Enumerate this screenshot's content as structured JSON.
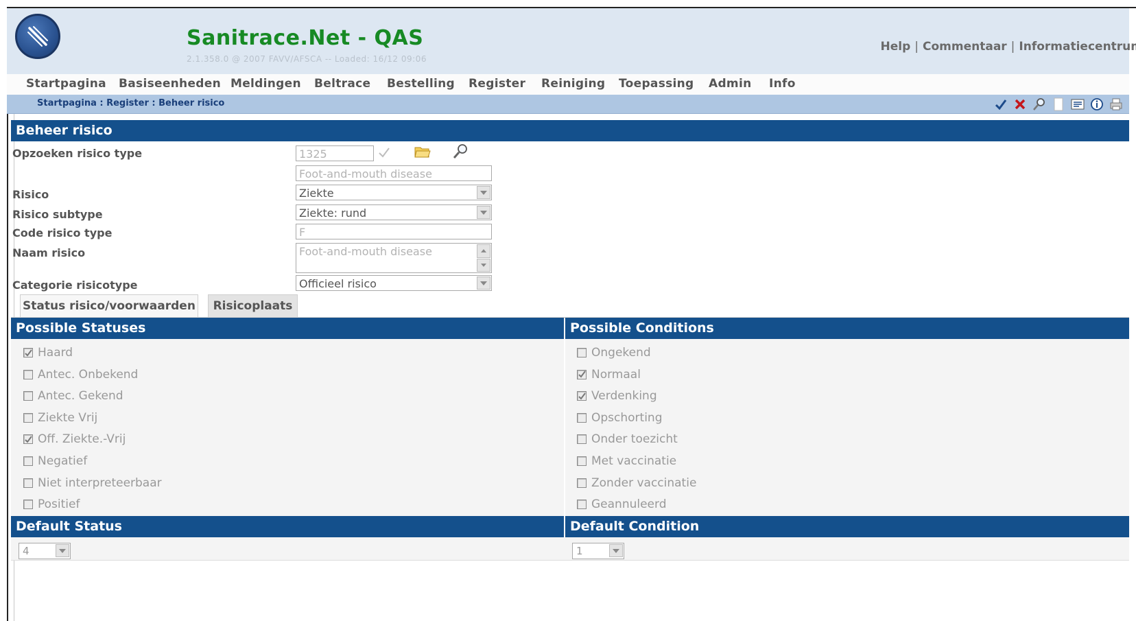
{
  "header": {
    "title": "Sanitrace.Net - QAS",
    "version": "2.1.358.0 @ 2007 FAVV/AFSCA -- Loaded: 16/12 09:06",
    "links": [
      "Help",
      "Commentaar",
      "Informatiecentrum"
    ]
  },
  "menu": [
    "Startpagina",
    "Basiseenheden",
    "Meldingen",
    "Beltrace",
    "Bestelling",
    "Register",
    "Reiniging",
    "Toepassing",
    "Admin",
    "Info"
  ],
  "breadcrumb": "Startpagina : Register : Beheer risico",
  "toolbar": {
    "icons": [
      "check-icon",
      "close-icon",
      "search-icon",
      "new-document-icon",
      "list-view-icon",
      "info-icon",
      "print-icon"
    ],
    "colors": {
      "check": "#1c4a8a",
      "close": "#c4161c"
    }
  },
  "page": {
    "title": "Beheer risico",
    "fields": {
      "lookup_label": "Opzoeken risico type",
      "lookup_code": "1325",
      "lookup_name": "Foot-and-mouth disease",
      "risico_label": "Risico",
      "risico_value": "Ziekte",
      "subtype_label": "Risico subtype",
      "subtype_value": "Ziekte: rund",
      "code_label": "Code risico type",
      "code_value": "F",
      "naam_label": "Naam risico",
      "naam_value": "Foot-and-mouth disease",
      "categorie_label": "Categorie risicotype",
      "categorie_value": "Officieel risico"
    },
    "tabs": [
      "Status risico/voorwaarden",
      "Risicoplaats"
    ],
    "statuses": {
      "heading": "Possible Statuses",
      "items": [
        {
          "label": "Haard",
          "checked": true
        },
        {
          "label": "Antec. Onbekend",
          "checked": false
        },
        {
          "label": "Antec. Gekend",
          "checked": false
        },
        {
          "label": "Ziekte Vrij",
          "checked": false
        },
        {
          "label": "Off. Ziekte.-Vrij",
          "checked": true
        },
        {
          "label": "Negatief",
          "checked": false
        },
        {
          "label": "Niet interpreteerbaar",
          "checked": false
        },
        {
          "label": "Positief",
          "checked": false
        }
      ]
    },
    "conditions": {
      "heading": "Possible Conditions",
      "items": [
        {
          "label": "Ongekend",
          "checked": false
        },
        {
          "label": "Normaal",
          "checked": true
        },
        {
          "label": "Verdenking",
          "checked": true
        },
        {
          "label": "Opschorting",
          "checked": false
        },
        {
          "label": "Onder toezicht",
          "checked": false
        },
        {
          "label": "Met vaccinatie",
          "checked": false
        },
        {
          "label": "Zonder vaccinatie",
          "checked": false
        },
        {
          "label": "Geannuleerd",
          "checked": false
        }
      ]
    },
    "default_status": {
      "heading": "Default Status",
      "value": "4"
    },
    "default_condition": {
      "heading": "Default Condition",
      "value": "1"
    }
  },
  "colors": {
    "brand_green": "#178a24",
    "header_bg": "#dde7f2",
    "bar_blue": "#14508c",
    "crumb_bg": "#aec6e2"
  }
}
